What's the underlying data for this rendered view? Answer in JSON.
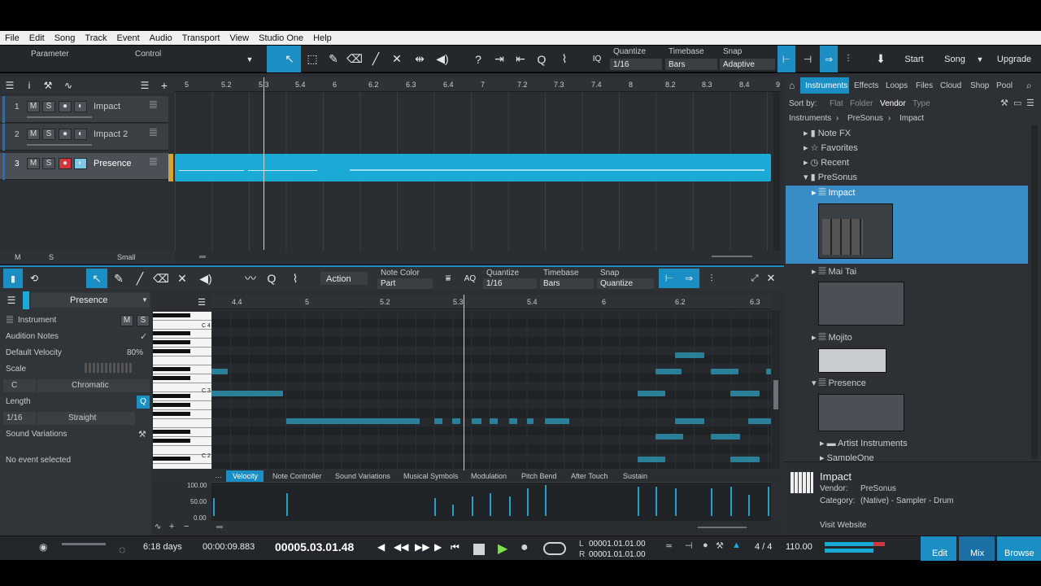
{
  "menu": [
    "File",
    "Edit",
    "Song",
    "Track",
    "Event",
    "Audio",
    "Transport",
    "View",
    "Studio One",
    "Help"
  ],
  "toolbar": {
    "parameter": "Parameter",
    "control": "Control",
    "quantize_label": "Quantize",
    "quantize_value": "1/16",
    "timebase_label": "Timebase",
    "timebase_value": "Bars",
    "snap_label": "Snap",
    "snap_value": "Adaptive",
    "start": "Start",
    "song": "Song",
    "upgrade": "Upgrade"
  },
  "ruler": [
    "5",
    "5.2",
    "5.3",
    "5.4",
    "6",
    "6.2",
    "6.3",
    "6.4",
    "7",
    "7.2",
    "7.3",
    "7.4",
    "8",
    "8.2",
    "8.3",
    "8.4",
    "9"
  ],
  "tracks": [
    {
      "num": "1",
      "name": "Impact"
    },
    {
      "num": "2",
      "name": "Impact 2"
    },
    {
      "num": "3",
      "name": "Presence"
    }
  ],
  "arrange_footer": {
    "m": "M",
    "s": "S",
    "size": "Small"
  },
  "editor": {
    "action": "Action",
    "note_color_label": "Note Color",
    "note_color_value": "Part",
    "quantize_label": "Quantize",
    "quantize_value": "1/16",
    "timebase_label": "Timebase",
    "timebase_value": "Bars",
    "snap_label": "Snap",
    "snap_value": "Quantize",
    "track_name": "Presence",
    "ruler": [
      "4.4",
      "5",
      "5.2",
      "5.3",
      "5.4",
      "6",
      "6.2",
      "6.3"
    ],
    "inspector": {
      "instrument": "Instrument",
      "audition_notes": "Audition Notes",
      "default_velocity": "Default Velocity",
      "default_velocity_value": "80%",
      "scale": "Scale",
      "scale_root": "C",
      "scale_type": "Chromatic",
      "length": "Length",
      "length_value": "1/16",
      "length_type": "Straight",
      "sound_variations": "Sound Variations",
      "no_event": "No event selected"
    },
    "key_labels": [
      "C 4",
      "C 3",
      "C 2"
    ],
    "lane_tabs": [
      "Velocity",
      "Note Controller",
      "Sound Variations",
      "Musical Symbols",
      "Modulation",
      "Pitch Bend",
      "After Touch",
      "Sustain"
    ],
    "vel_scale": [
      "100.00",
      "50.00",
      "0.00"
    ]
  },
  "browser": {
    "tabs": [
      "Instruments",
      "Effects",
      "Loops",
      "Files",
      "Cloud",
      "Shop",
      "Pool"
    ],
    "sort_by": "Sort by:",
    "sort_opts": [
      "Flat",
      "Folder",
      "Vendor",
      "Type"
    ],
    "breadcrumb": [
      "Instruments",
      "PreSonus",
      "Impact"
    ],
    "tree": [
      "Note FX",
      "Favorites",
      "Recent",
      "PreSonus",
      "Impact",
      "Mai Tai",
      "Mojito",
      "Presence",
      "Artist Instruments",
      "SampleOne"
    ],
    "info": {
      "name": "Impact",
      "vendor_label": "Vendor:",
      "vendor": "PreSonus",
      "category_label": "Category:",
      "category": "(Native) - Sampler - Drum",
      "website": "Visit Website"
    }
  },
  "transport": {
    "days": "6:18 days",
    "time": "00:00:09.883",
    "position": "00005.03.01.48",
    "loop_l": "00001.01.01.00",
    "loop_r": "00001.01.01.00",
    "signature": "4 / 4",
    "tempo": "110.00",
    "edit": "Edit",
    "mix": "Mix",
    "browse": "Browse"
  }
}
